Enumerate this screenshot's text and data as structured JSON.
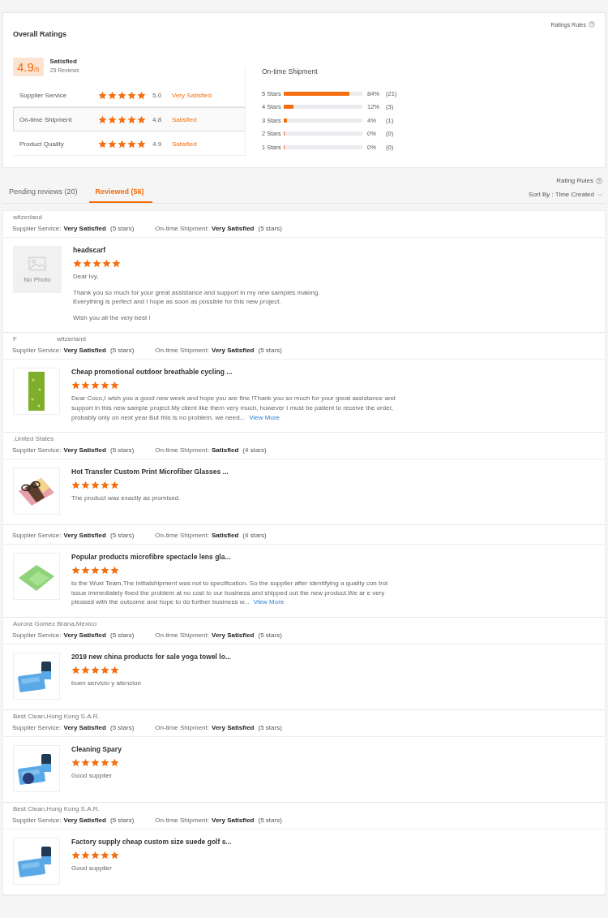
{
  "overall": {
    "rules_link": "Ratings Rules",
    "title": "Overall Ratings",
    "score": "4.9$_{/5}$",
    "verdict": "Satisfied",
    "count": "25 Reviews",
    "aspects": [
      {
        "name": "Supplier Service",
        "stars": 5,
        "value": "5.0",
        "verdict": "Very Satisfied",
        "selected": false
      },
      {
        "name": "On-time Shipment",
        "stars": 5,
        "value": "4.8",
        "verdict": "Satisfied",
        "selected": true
      },
      {
        "name": "Product Quality",
        "stars": 5,
        "value": "4.9",
        "verdict": "Satisfied",
        "selected": false
      }
    ],
    "breakdown": {
      "title": "On-time Shipment",
      "rows": [
        {
          "label": "5 Stars",
          "level": 0.84,
          "percent": "84%",
          "count": "(21)"
        },
        {
          "label": "4 Stars",
          "level": 0.12,
          "percent": "12%",
          "count": "(3)"
        },
        {
          "label": "3 Stars",
          "level": 0.04,
          "percent": "4%",
          "count": "(1)"
        },
        {
          "label": "2 Stars",
          "level": 0,
          "percent": "0%",
          "count": "(0)"
        },
        {
          "label": "1 Stars",
          "level": 0,
          "percent": "0%",
          "count": "(0)"
        }
      ]
    }
  },
  "tabs": [
    {
      "label": "Pending reviews (20)",
      "selected": false
    },
    {
      "label": "Reviewed (56)",
      "selected": true
    }
  ],
  "rating_rules": "Rating Rules",
  "sort": "Sort By : Time Created",
  "reviews": [
    {
      "buyer": [
        "witzerland"
      ],
      "supplier_label": "Supplier Service:",
      "supplier_verdict": "Very Satisfied",
      "supplier_stars": "(5 stars)",
      "shipment_label": "On-time Shipment:",
      "shipment_verdict": "Very Satisfied",
      "shipment_stars": "(5 stars)",
      "product": {
        "photo": false,
        "no_photo_label": "No Photo",
        "title": "headscarf",
        "stars": 5,
        "comment": [
          "Dear Ivy,",
          "Thank you so much for your great assistance and support in my new samples making.\nEverything is perfect and I hope as soon as possible for this new project.",
          "Wish you all the very best !"
        ]
      }
    },
    {
      "buyer": [
        "F",
        "witzerland"
      ],
      "supplier_label": "Supplier Service:",
      "supplier_verdict": "Very Satisfied",
      "supplier_stars": "(5 stars)",
      "shipment_label": "On-time Shipment:",
      "shipment_verdict": "Very Satisfied",
      "shipment_stars": "(5 stars)",
      "product": {
        "photo": true,
        "title": "Cheap promotional outdoor breathable cycling ...",
        "stars": 5,
        "comment": [
          "Dear Coco,I wish you a good new week and hope you are fine !Thank you so much for your great assistance and support in this new sample project.My client like them very much, however I must be patient to receive the order, probably only on next year But this is no problem, we need..."
        ],
        "view_more": "View More"
      }
    },
    {
      "buyer": [
        ",United States"
      ],
      "supplier_label": "Supplier Service:",
      "supplier_verdict": "Very Satisfied",
      "supplier_stars": "(5 stars)",
      "shipment_label": "On-time Shipment:",
      "shipment_verdict": "Satisfied",
      "shipment_stars": "(4 stars)",
      "product": {
        "photo": true,
        "title": "Hot Transfer Custom Print Microfiber Glasses ...",
        "stars": 5,
        "comment": [
          "The product was exactly as promised."
        ]
      }
    },
    {
      "supplier_label": "Supplier Service:",
      "supplier_verdict": "Very Satisfied",
      "supplier_stars": "(5 stars)",
      "shipment_label": "On-time Shipment:",
      "shipment_verdict": "Satisfied",
      "shipment_stars": "(4 stars)",
      "product": {
        "photo": true,
        "title": "Popular products microfibre spectacle lens gla...",
        "stars": 5,
        "comment": [
          "to the Wuxi Team,The initialshipment was not to specification. So the supplier after identifying a quality con trol issue immediately fixed the problem at no cost to our business and shipped out the new product.We ar e very pleased with the outcome and hope to do further business w..."
        ],
        "view_more": "View More"
      }
    },
    {
      "buyer": [
        "Aurora Gomez Brana,Mexico"
      ],
      "supplier_label": "Supplier Service:",
      "supplier_verdict": "Very Satisfied",
      "supplier_stars": "(5 stars)",
      "shipment_label": "On-time Shipment:",
      "shipment_verdict": "Very Satisfied",
      "shipment_stars": "(5 stars)",
      "product": {
        "photo": true,
        "title": "2019 new china products for sale yoga towel lo...",
        "stars": 5,
        "comment": [
          "buen servicio y atencion"
        ]
      }
    },
    {
      "buyer": [
        "Best Clean,Hong Kong S.A.R."
      ],
      "supplier_label": "Supplier Service:",
      "supplier_verdict": "Very Satisfied",
      "supplier_stars": "(5 stars)",
      "shipment_label": "On-time Shipment:",
      "shipment_verdict": "Very Satisfied",
      "shipment_stars": "(5 stars)",
      "product": {
        "photo": true,
        "title": "Cleaning Spary",
        "stars": 5,
        "comment": [
          "Good supplier"
        ]
      }
    },
    {
      "buyer": [
        "Best Clean,Hong Kong S.A.R."
      ],
      "supplier_label": "Supplier Service:",
      "supplier_verdict": "Very Satisfied",
      "supplier_stars": "(5 stars)",
      "shipment_label": "On-time Shipment:",
      "shipment_verdict": "Very Satisfied",
      "shipment_stars": "(5 stars)",
      "product": {
        "photo": true,
        "title": "Factory supply cheap custom size suede golf s...",
        "stars": 5,
        "comment": [
          "Good supplier"
        ]
      }
    }
  ]
}
